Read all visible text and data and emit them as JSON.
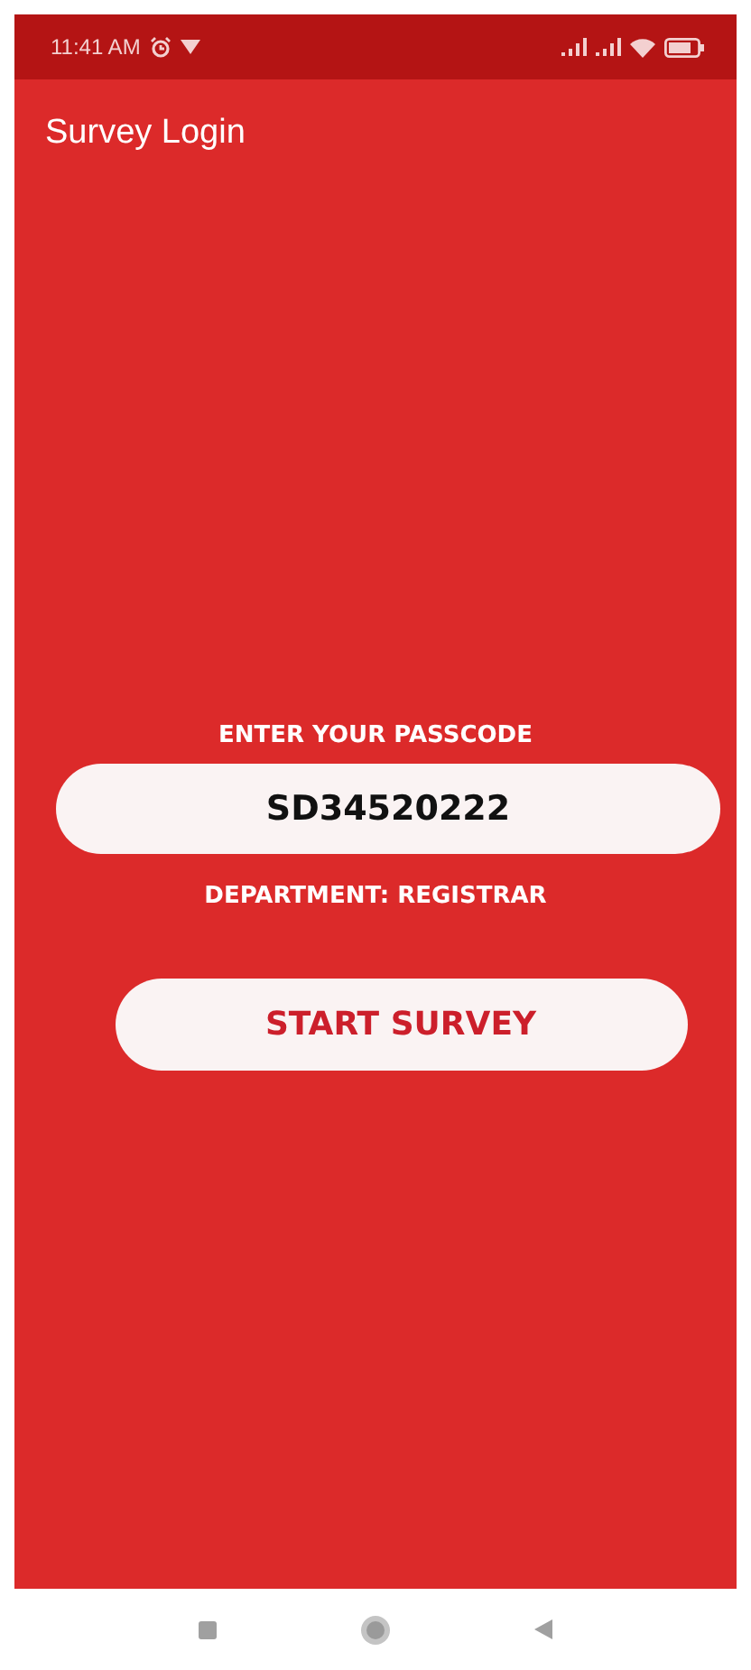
{
  "status_bar": {
    "time": "11:41 AM"
  },
  "app_bar": {
    "title": "Survey Login"
  },
  "form": {
    "label": "ENTER YOUR PASSCODE",
    "passcode": "SD34520222",
    "department": "DEPARTMENT: REGISTRAR",
    "button": "START SURVEY"
  }
}
